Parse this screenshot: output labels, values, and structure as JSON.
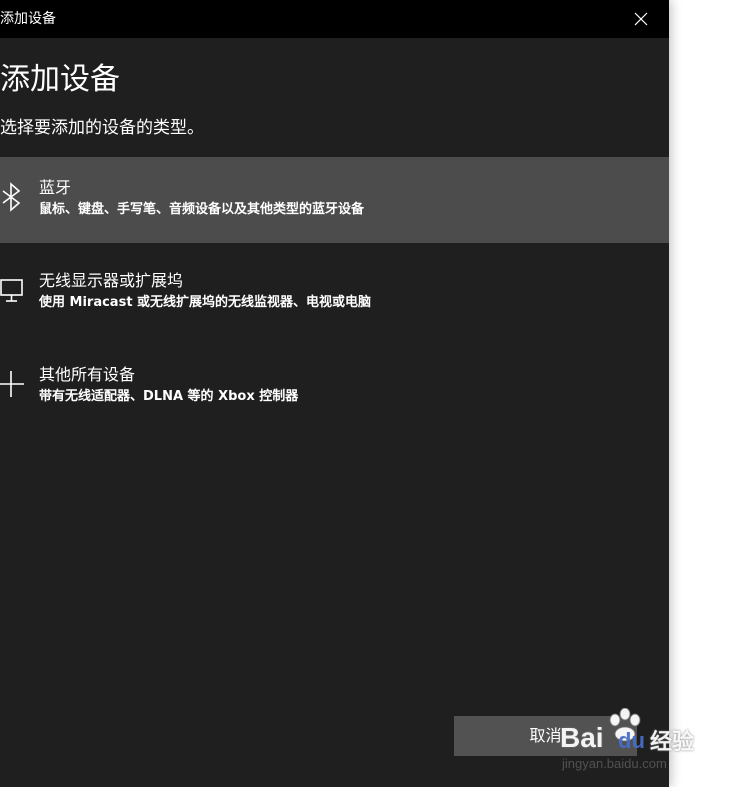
{
  "window": {
    "title": "添加设备",
    "close_icon": "close-icon"
  },
  "header": {
    "title": "添加设备",
    "subtitle": "选择要添加的设备的类型。"
  },
  "options": [
    {
      "icon": "bluetooth-icon",
      "title": "蓝牙",
      "description": "鼠标、键盘、手写笔、音频设备以及其他类型的蓝牙设备",
      "selected": true
    },
    {
      "icon": "monitor-icon",
      "title": "无线显示器或扩展坞",
      "description": "使用 Miracast 或无线扩展坞的无线监视器、电视或电脑",
      "selected": false
    },
    {
      "icon": "plus-icon",
      "title": "其他所有设备",
      "description": "带有无线适配器、DLNA 等的 Xbox 控制器",
      "selected": false
    }
  ],
  "footer": {
    "cancel_label": "取消"
  },
  "watermark": {
    "brand": "Bai",
    "brand_suffix": "du",
    "product": "经验",
    "url": "jingyan.baidu.com"
  },
  "colors": {
    "dialog_bg": "#1f1f1f",
    "titlebar_bg": "#000000",
    "selected_bg": "#4c4c4c",
    "button_bg": "#525252",
    "text": "#ffffff"
  }
}
